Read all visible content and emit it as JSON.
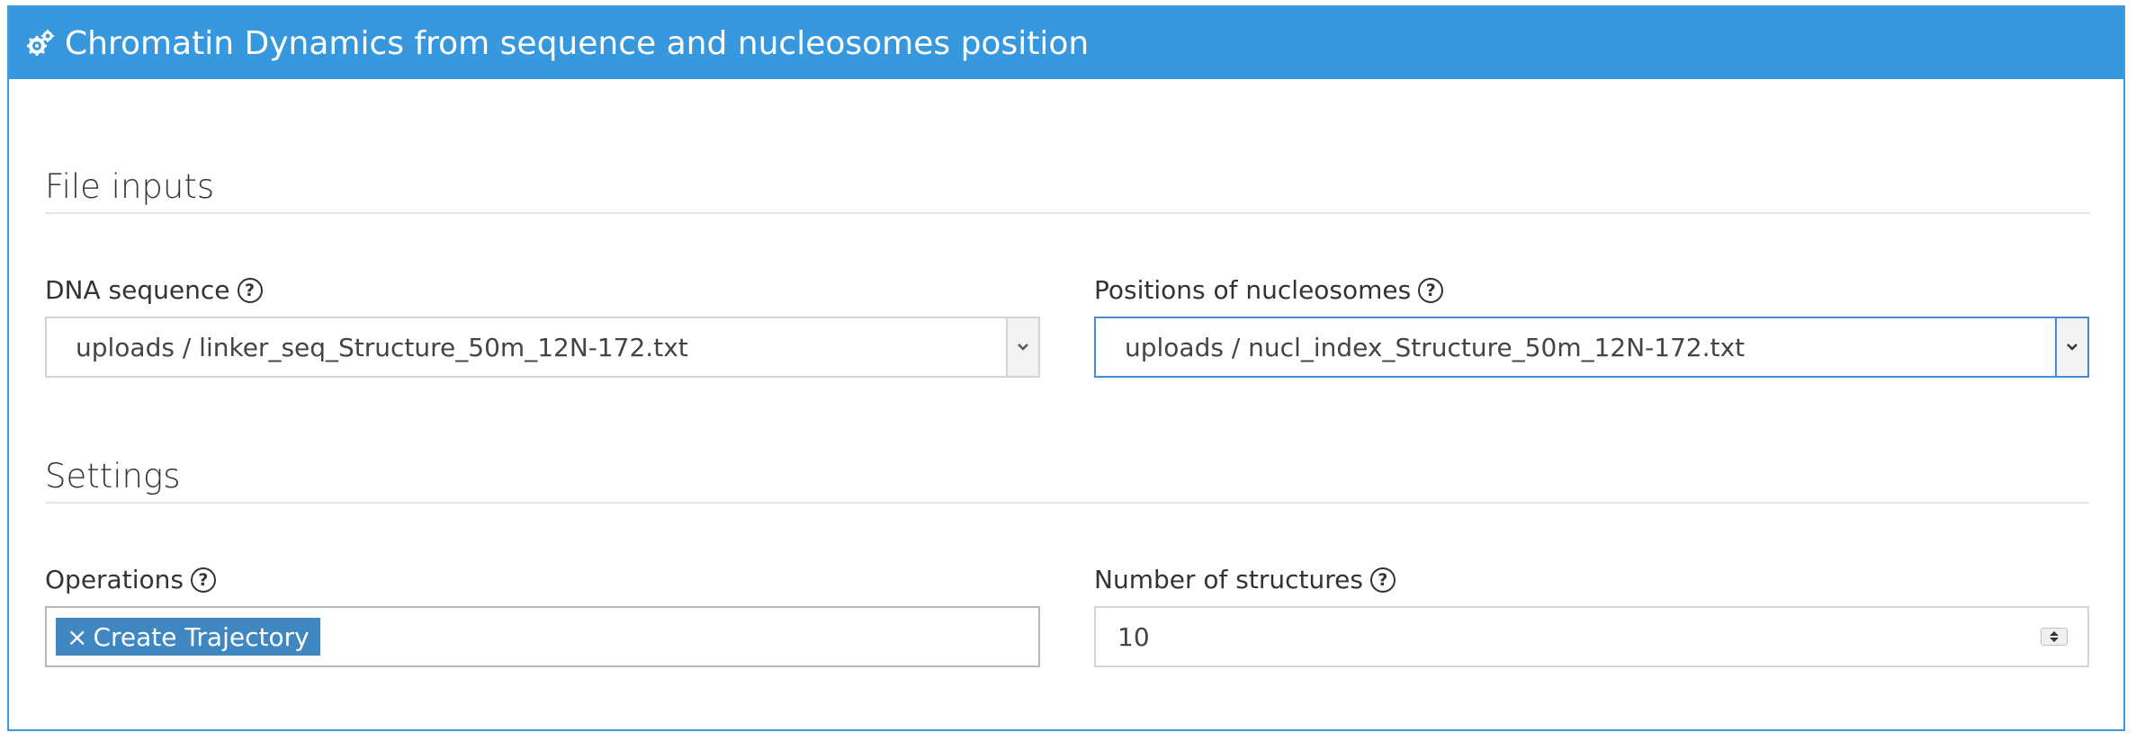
{
  "header": {
    "title": "Chromatin Dynamics from sequence and nucleosomes position",
    "icon": "gears-icon"
  },
  "file_inputs": {
    "section_title": "File inputs",
    "dna_sequence": {
      "label": "DNA sequence",
      "value": "uploads / linker_seq_Structure_50m_12N-172.txt"
    },
    "nucleosome_positions": {
      "label": "Positions of nucleosomes",
      "value": "uploads / nucl_index_Structure_50m_12N-172.txt"
    }
  },
  "settings": {
    "section_title": "Settings",
    "operations": {
      "label": "Operations",
      "tags": [
        "Create Trajectory"
      ],
      "remove_glyph": "×"
    },
    "structures": {
      "label": "Number of structures",
      "value": "10"
    }
  },
  "help_glyph": "?",
  "colors": {
    "header_bg": "#3898dd",
    "tag_bg": "#3f87c1",
    "focus_border": "#4a8bd0"
  }
}
